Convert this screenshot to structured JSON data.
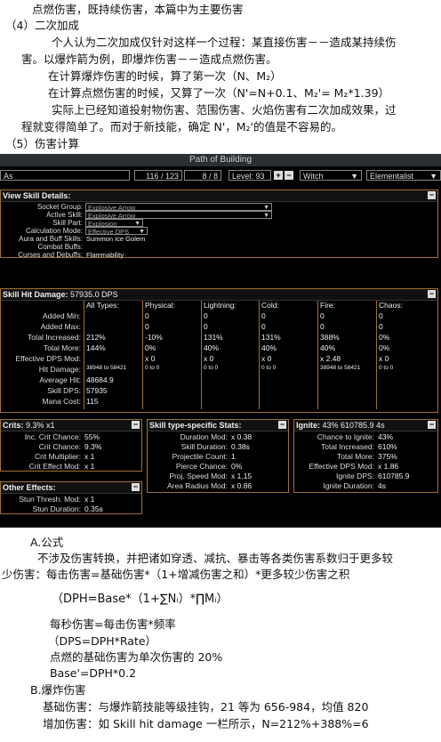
{
  "top_text": {
    "line1": "点燃伤害，既持续伤害，本篇中为主要伤害",
    "heading4": "（4）二次加成",
    "para1a": "个人认为二次加成仅针对这样一个过程：某直接伤害－－造成某持续伤",
    "para1b": "害。以爆炸箭为例，即爆炸伤害－－造成点燃伤害。",
    "para2": "在计算爆炸伤害的时候，算了第一次（N、M₂）",
    "para3": "在计算点燃伤害的时候，又算了一次（N'=N+0.1、M₂'= M₂*1.39）",
    "para4a": "实际上已经知道投射物伤害、范围伤害、火焰伤害有二次加成效果，过",
    "para4b": "程就变得简单了。而对于新技能，确定 N'，M₂'的值是不容易的。",
    "heading5": "（5）伤害计算"
  },
  "pob": {
    "title": "Path of Building",
    "as_field": "As",
    "points": "116 / 123",
    "ascend": "8 / 8",
    "level": "Level: 93",
    "class": "Witch",
    "ascendancy": "Elementalist",
    "skill_details": {
      "title": "View Skill Details:",
      "rows": [
        {
          "label": "Socket Group:",
          "value": "Explosive Arrow",
          "dropdown": true
        },
        {
          "label": "Active Skill:",
          "value": "Explosive Arrow",
          "dropdown": true
        },
        {
          "label": "Skill Part:",
          "value": "Explosion",
          "dropdown": true
        },
        {
          "label": "Calculation Mode:",
          "value": "Effective DPS",
          "dropdown": true
        },
        {
          "label": "Aura and Buff Skills:",
          "value": "Summon Ice Golem",
          "dropdown": false
        },
        {
          "label": "Combat Buffs:",
          "value": "",
          "dropdown": false
        },
        {
          "label": "Curses and Debuffs:",
          "value": "Flammability",
          "dropdown": false
        }
      ]
    },
    "hit_damage": {
      "title": "Skill Hit Damage:",
      "title_value": "57935.0 DPS",
      "columns": [
        "All Types:",
        "Physical:",
        "Lightning:",
        "Cold:",
        "Fire:",
        "Chaos:"
      ],
      "rows": [
        {
          "label": "Added Min:",
          "cells": [
            "",
            "0",
            "0",
            "0",
            "0",
            "0"
          ]
        },
        {
          "label": "Added Max:",
          "cells": [
            "",
            "0",
            "0",
            "0",
            "0",
            "0"
          ]
        },
        {
          "label": "Total Increased:",
          "cells": [
            "212%",
            "-10%",
            "131%",
            "131%",
            "388%",
            "0%"
          ]
        },
        {
          "label": "Total More:",
          "cells": [
            "144%",
            "0%",
            "40%",
            "40%",
            "40%",
            "0%"
          ]
        },
        {
          "label": "Effective DPS Mod:",
          "cells": [
            "",
            "x 0",
            "x 0",
            "x 0",
            "x 2.48",
            "x 0"
          ]
        },
        {
          "label": "Hit Damage:",
          "cells": [
            "38948 to 58421",
            "0 to 0",
            "0 to 0",
            "0 to 0",
            "38948 to 58421",
            "0 to 0"
          ]
        },
        {
          "label": "Average Hit:",
          "cells": [
            "48684.9",
            "",
            "",
            "",
            "",
            ""
          ]
        },
        {
          "label": "Skill DPS:",
          "cells": [
            "57935",
            "",
            "",
            "",
            "",
            ""
          ]
        },
        {
          "label": "Mana Cost:",
          "cells": [
            "115",
            "",
            "",
            "",
            "",
            ""
          ]
        }
      ]
    },
    "crits": {
      "title": "Crits:",
      "title_value": "9.3% x1",
      "rows": [
        {
          "label": "Inc. Crit Chance:",
          "value": "55%"
        },
        {
          "label": "Crit Chance:",
          "value": "9.3%"
        },
        {
          "label": "Crit Multiplier:",
          "value": "x 1"
        },
        {
          "label": "Crit Effect Mod:",
          "value": "x 1"
        }
      ]
    },
    "type_stats": {
      "title": "Skill type-specific Stats:",
      "rows": [
        {
          "label": "Duration Mod:",
          "value": "x 0.38"
        },
        {
          "label": "Skill Duration:",
          "value": "0.38s"
        },
        {
          "label": "Projectile Count:",
          "value": "1"
        },
        {
          "label": "Pierce Chance:",
          "value": "0%"
        },
        {
          "label": "Proj. Speed Mod:",
          "value": "x 1.15"
        },
        {
          "label": "Area Radius Mod:",
          "value": "x 0.86"
        }
      ]
    },
    "ignite": {
      "title": "Ignite:",
      "title_value": "43% 610785.9 4s",
      "rows": [
        {
          "label": "Chance to Ignite:",
          "value": "43%"
        },
        {
          "label": "Total Increased:",
          "value": "610%"
        },
        {
          "label": "Total More:",
          "value": "375%"
        },
        {
          "label": "Effective DPS Mod:",
          "value": "x 1.86"
        },
        {
          "label": "Ignite DPS:",
          "value": "610785.9"
        },
        {
          "label": "Ignite Duration:",
          "value": "4s"
        }
      ]
    },
    "other": {
      "title": "Other Effects:",
      "rows": [
        {
          "label": "Stun Thresh. Mod:",
          "value": "x 1"
        },
        {
          "label": "Stun Duration:",
          "value": "0.35s"
        }
      ]
    }
  },
  "bottom_text": {
    "a_head": "A.公式",
    "a_para1a": "不涉及伤害转换，并把诸如穿透、减抗、暴击等各类伤害系数归于更多较",
    "a_para1b": "少伤害：每击伤害=基础伤害*（1+增减伤害之和）*更多较少伤害之积",
    "formula": "（DPH=Base*（1+∑Nᵢ）*∏Mᵢ）",
    "dps_line": "每秒伤害=每击伤害*频率",
    "dps_formula": "（DPS=DPH*Rate）",
    "ignite_line": "点燃的基础伤害为单次伤害的 20%",
    "base_formula": "Base'=DPH*0.2",
    "b_head": "B.爆炸伤害",
    "b_line1": "基础伤害：与爆炸箭技能等级挂钩，21 等为 656-984，均值 820",
    "b_line2": "增加伤害：如 Skill  hit damage 一栏所示，N=212%+388%=6"
  }
}
